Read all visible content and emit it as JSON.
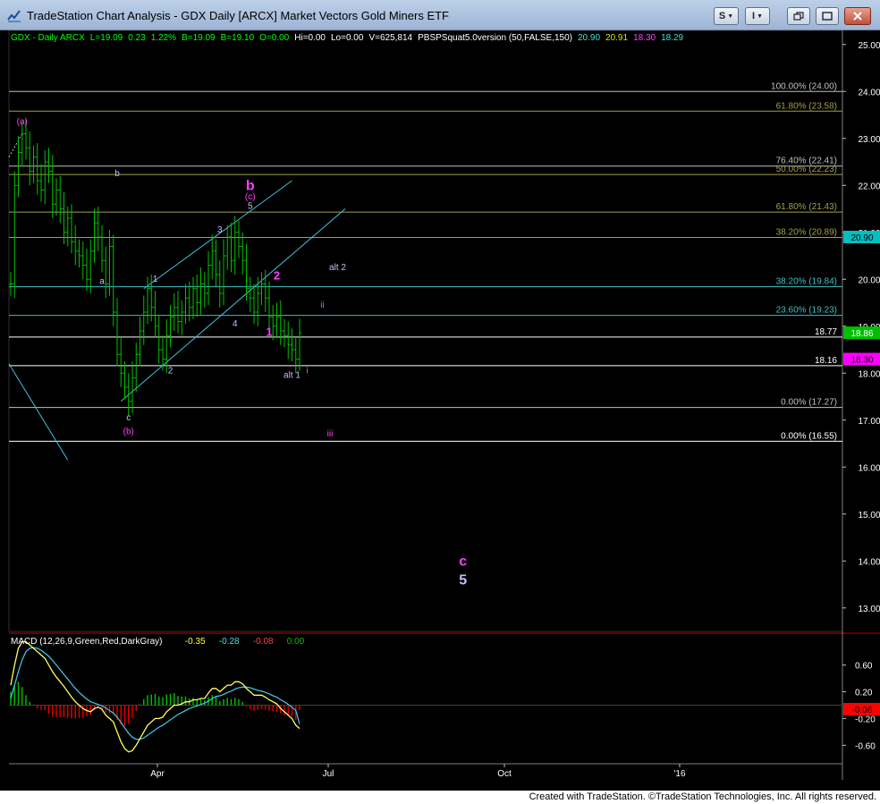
{
  "window": {
    "title": "TradeStation Chart Analysis - GDX Daily [ARCX] Market Vectors Gold Miners ETF",
    "buttons": {
      "s_label": "S",
      "i_label": "I"
    }
  },
  "header": [
    {
      "text": "GDX - Daily  ARCX",
      "color": "#00ff00"
    },
    {
      "text": "L=19.09",
      "color": "#00ff00"
    },
    {
      "text": "0.23",
      "color": "#00ff00"
    },
    {
      "text": "1.22%",
      "color": "#00ff00"
    },
    {
      "text": "B=19.09",
      "color": "#00ff00"
    },
    {
      "text": "B=19.10",
      "color": "#00ff00"
    },
    {
      "text": "O=0.00",
      "color": "#00ff00"
    },
    {
      "text": "Hi=0.00",
      "color": "#ffffff"
    },
    {
      "text": "Lo=0.00",
      "color": "#ffffff"
    },
    {
      "text": "V=625,814",
      "color": "#ffffff"
    },
    {
      "text": "PBSPSquat5.0version (50,FALSE,150)",
      "color": "#ffffff"
    },
    {
      "text": "20.90",
      "color": "#40e0e0"
    },
    {
      "text": "20.91",
      "color": "#e0e000"
    },
    {
      "text": "18.30",
      "color": "#ff40ff"
    },
    {
      "text": "18.29",
      "color": "#40e0e0"
    }
  ],
  "chart_data": {
    "type": "candlestick",
    "price_axis": {
      "ylim": [
        12.5,
        25.3
      ],
      "ticks": [
        "25.00",
        "24.00",
        "23.00",
        "22.00",
        "21.00",
        "20.00",
        "19.00",
        "18.00",
        "17.00",
        "16.00",
        "15.00",
        "14.00",
        "13.00"
      ]
    },
    "time_axis": {
      "labels": [
        "Apr",
        "Jul",
        "Oct",
        "'16"
      ]
    },
    "levels": [
      {
        "label": "100.00% (24.00)",
        "value": 24.0,
        "color": "#c0c0c0"
      },
      {
        "label": "61.80% (23.58)",
        "value": 23.58,
        "color": "#a0a050"
      },
      {
        "label": "76.40% (22.41)",
        "value": 22.41,
        "color": "#c0c0c0"
      },
      {
        "label": "50.00% (22.23)",
        "value": 22.23,
        "color": "#a0a050"
      },
      {
        "label": "61.80% (21.43)",
        "value": 21.43,
        "color": "#a0a050"
      },
      {
        "label": "38.20% (20.89)",
        "value": 20.89,
        "color": "#a0a050"
      },
      {
        "label": "38.20% (19.84)",
        "value": 19.84,
        "color": "#40c0c0"
      },
      {
        "label": "23.60% (19.23)",
        "value": 19.23,
        "color": "#40c0c0"
      },
      {
        "label": "18.77",
        "value": 18.77,
        "color": "#ffffff"
      },
      {
        "label": "18.16",
        "value": 18.16,
        "color": "#ffffff"
      },
      {
        "label": "0.00% (17.27)",
        "value": 17.27,
        "color": "#c0c0c0"
      },
      {
        "label": "0.00% (16.55)",
        "value": 16.55,
        "color": "#ffffff"
      }
    ],
    "price_tags": [
      {
        "value": "20.90",
        "bg": "#00c0c0",
        "color": "#000000"
      },
      {
        "value": "18.86",
        "bg": "#00c000",
        "color": "#ffffff"
      },
      {
        "value": "18.30",
        "bg": "#ff00ff",
        "color": "#000000"
      }
    ],
    "closes": [
      19.9,
      22.0,
      22.7,
      23.1,
      22.8,
      22.3,
      22.6,
      22.1,
      21.9,
      22.5,
      22.3,
      21.6,
      21.9,
      21.5,
      21.0,
      21.3,
      20.8,
      20.6,
      20.5,
      20.3,
      20.0,
      20.6,
      21.2,
      20.9,
      20.4,
      19.9,
      20.7,
      19.3,
      18.4,
      18.0,
      17.7,
      17.4,
      17.9,
      18.4,
      18.9,
      19.3,
      19.8,
      19.4,
      19.0,
      18.5,
      18.3,
      18.8,
      19.2,
      19.4,
      19.1,
      19.3,
      19.6,
      19.4,
      19.8,
      19.5,
      19.9,
      19.7,
      20.3,
      20.6,
      20.1,
      19.7,
      20.5,
      20.9,
      20.4,
      21.0,
      20.7,
      20.4,
      19.8,
      19.6,
      19.3,
      19.7,
      19.9,
      19.6,
      19.2,
      19.0,
      19.2,
      18.9,
      18.8,
      18.6,
      18.5,
      18.3,
      18.86
    ],
    "wave_labels": [
      {
        "text": "(a)",
        "price": 23.3,
        "bar": 3,
        "color": "#ff40ff",
        "size": 10
      },
      {
        "text": "b",
        "price": 22.2,
        "bar": 28,
        "color": "#c0c0ff",
        "size": 10
      },
      {
        "text": "a",
        "price": 19.9,
        "bar": 24,
        "color": "#c0c0ff",
        "size": 10
      },
      {
        "text": "c",
        "price": 17.0,
        "bar": 31,
        "color": "#c0c0ff",
        "size": 10
      },
      {
        "text": "(b)",
        "price": 16.7,
        "bar": 31,
        "color": "#ff40ff",
        "size": 10
      },
      {
        "text": "1",
        "price": 19.95,
        "bar": 38,
        "color": "#c0c0ff",
        "size": 10
      },
      {
        "text": "2",
        "price": 18.0,
        "bar": 42,
        "color": "#c0c0ff",
        "size": 10
      },
      {
        "text": "3",
        "price": 21.0,
        "bar": 55,
        "color": "#c0c0ff",
        "size": 10
      },
      {
        "text": "4",
        "price": 19.0,
        "bar": 59,
        "color": "#c0c0ff",
        "size": 10
      },
      {
        "text": "5",
        "price": 21.5,
        "bar": 63,
        "color": "#c0c0ff",
        "size": 10
      },
      {
        "text": "(c)",
        "price": 21.7,
        "bar": 63,
        "color": "#ff40ff",
        "size": 10
      },
      {
        "text": "b",
        "price": 21.9,
        "bar": 63,
        "color": "#ff40ff",
        "size": 16
      },
      {
        "text": "2",
        "price": 20.0,
        "bar": 70,
        "color": "#ff40ff",
        "size": 13
      },
      {
        "text": "1",
        "price": 18.8,
        "bar": 68,
        "color": "#ff40ff",
        "size": 13
      },
      {
        "text": "alt 2",
        "price": 20.2,
        "bar": 86,
        "color": "#c0c0ff",
        "size": 10
      },
      {
        "text": "ii",
        "price": 19.4,
        "bar": 82,
        "color": "#ff40ff",
        "size": 10
      },
      {
        "text": "alt 1",
        "price": 17.9,
        "bar": 74,
        "color": "#c0c0ff",
        "size": 10
      },
      {
        "text": "i",
        "price": 18.0,
        "bar": 78,
        "color": "#ff40ff",
        "size": 10
      },
      {
        "text": "iii",
        "price": 16.65,
        "bar": 84,
        "color": "#ff40ff",
        "size": 10
      },
      {
        "text": "c",
        "price": 13.9,
        "bar": 119,
        "color": "#ff40ff",
        "size": 16
      },
      {
        "text": "5",
        "price": 13.5,
        "bar": 119,
        "color": "#c0c0ff",
        "size": 16
      }
    ],
    "macd": {
      "title": "MACD (12,26,9,Green,Red,DarkGray)",
      "values": [
        {
          "text": "-0.35",
          "color": "#ffff40"
        },
        {
          "text": "-0.28",
          "color": "#40e0e0"
        },
        {
          "text": "-0.08",
          "color": "#ff4040"
        },
        {
          "text": "0.00",
          "color": "#00c000"
        }
      ],
      "ticks": [
        "0.60",
        "0.20",
        "-0.20",
        "-0.60"
      ],
      "ylim": [
        -0.85,
        1.05
      ],
      "tag": {
        "value": "-0.06",
        "bg": "#ff0000",
        "color": "#000000"
      },
      "macd_line": [
        0.3,
        0.6,
        0.85,
        0.95,
        0.95,
        0.9,
        0.85,
        0.8,
        0.75,
        0.7,
        0.6,
        0.5,
        0.42,
        0.35,
        0.28,
        0.2,
        0.12,
        0.05,
        0.0,
        -0.05,
        -0.08,
        -0.1,
        -0.05,
        -0.03,
        -0.06,
        -0.15,
        -0.2,
        -0.25,
        -0.4,
        -0.55,
        -0.65,
        -0.7,
        -0.68,
        -0.6,
        -0.5,
        -0.4,
        -0.3,
        -0.25,
        -0.2,
        -0.2,
        -0.18,
        -0.1,
        -0.05,
        0.0,
        0.0,
        0.02,
        0.05,
        0.05,
        0.08,
        0.08,
        0.1,
        0.1,
        0.18,
        0.25,
        0.25,
        0.2,
        0.25,
        0.3,
        0.3,
        0.35,
        0.35,
        0.32,
        0.25,
        0.2,
        0.15,
        0.15,
        0.15,
        0.12,
        0.08,
        0.05,
        0.02,
        -0.05,
        -0.1,
        -0.15,
        -0.2,
        -0.3,
        -0.35
      ],
      "signal_line": [
        0.1,
        0.3,
        0.5,
        0.68,
        0.8,
        0.85,
        0.86,
        0.85,
        0.82,
        0.78,
        0.73,
        0.67,
        0.6,
        0.53,
        0.46,
        0.39,
        0.32,
        0.25,
        0.19,
        0.14,
        0.09,
        0.05,
        0.03,
        0.01,
        -0.01,
        -0.04,
        -0.08,
        -0.12,
        -0.18,
        -0.26,
        -0.34,
        -0.42,
        -0.48,
        -0.51,
        -0.51,
        -0.49,
        -0.45,
        -0.41,
        -0.37,
        -0.33,
        -0.3,
        -0.26,
        -0.22,
        -0.18,
        -0.14,
        -0.11,
        -0.08,
        -0.05,
        -0.03,
        -0.01,
        0.01,
        0.03,
        0.06,
        0.1,
        0.13,
        0.14,
        0.16,
        0.19,
        0.21,
        0.24,
        0.26,
        0.27,
        0.27,
        0.26,
        0.24,
        0.22,
        0.21,
        0.19,
        0.17,
        0.14,
        0.12,
        0.08,
        0.05,
        0.01,
        -0.03,
        -0.08,
        -0.28
      ]
    }
  },
  "footer": {
    "text": "Created with TradeStation. ©TradeStation Technologies, Inc. All rights reserved."
  }
}
